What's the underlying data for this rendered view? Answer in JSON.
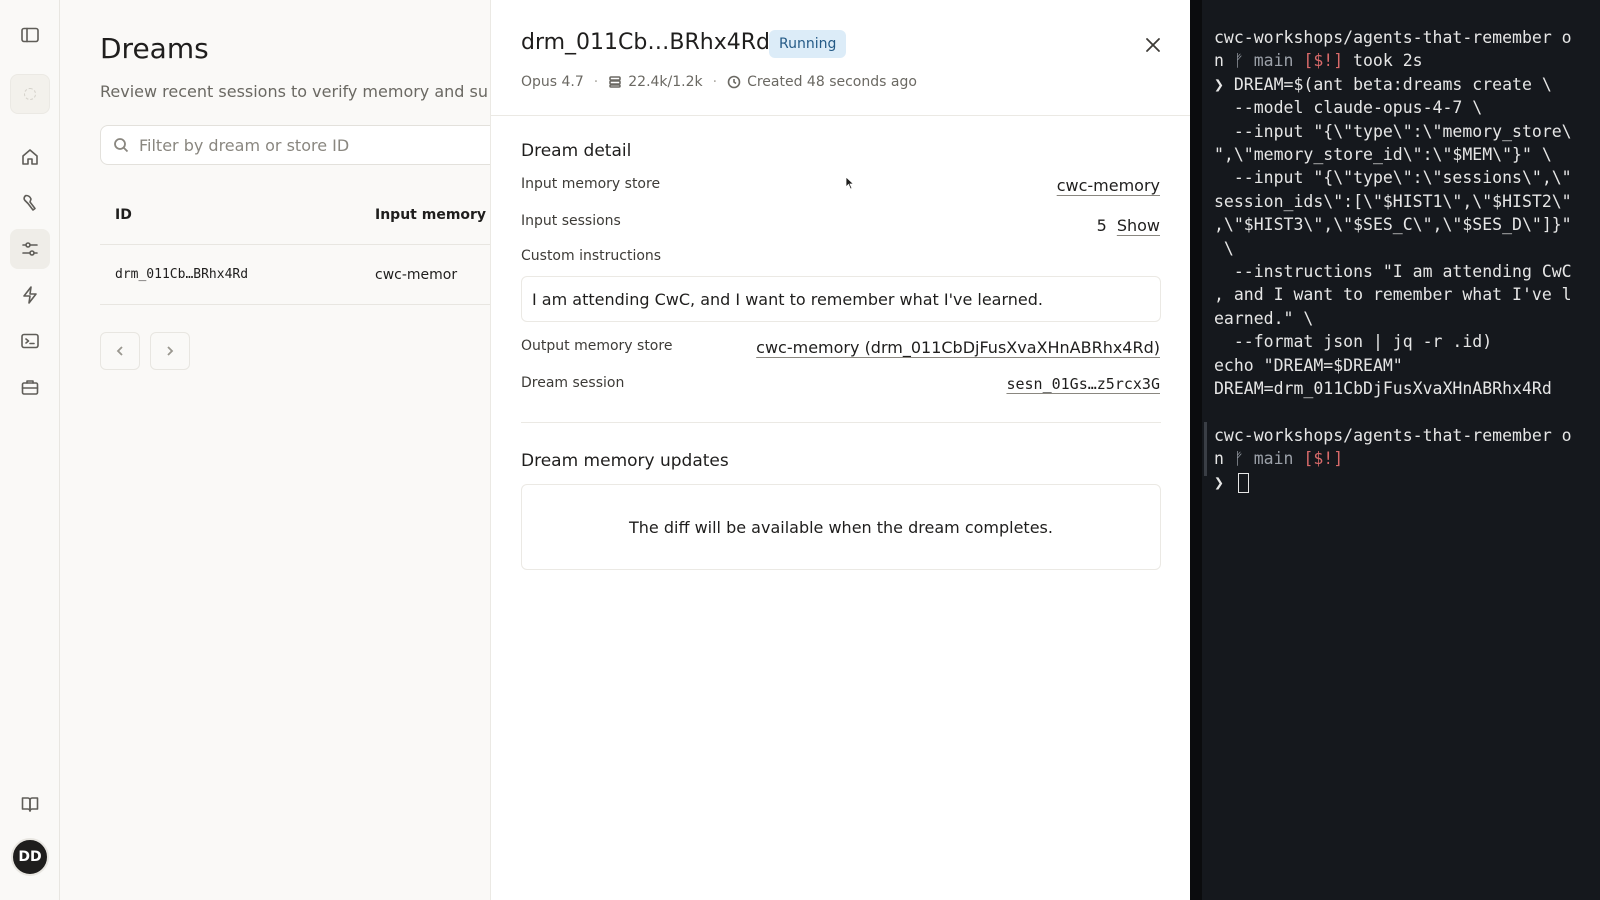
{
  "rail": {
    "items": [
      "sidebar-toggle",
      "home",
      "tools",
      "dreams",
      "events",
      "terminal",
      "briefcase"
    ],
    "docs_icon": "book-icon",
    "avatar_initials": "DD"
  },
  "list": {
    "title": "Dreams",
    "subtitle": "Review recent sessions to verify memory and su",
    "filter_placeholder": "Filter by dream or store ID",
    "columns": [
      "ID",
      "Input memory"
    ],
    "rows": [
      {
        "id": "drm_011Cb…BRhx4Rd",
        "input_memory": "cwc-memor"
      }
    ]
  },
  "detail": {
    "title": "drm_011Cb…BRhx4Rd",
    "status": "Running",
    "model": "Opus 4.7",
    "tokens": "22.4k/1.2k",
    "created": "Created 48 seconds ago",
    "section_detail": "Dream detail",
    "input_store_label": "Input memory store",
    "input_store_value": "cwc-memory",
    "input_sessions_label": "Input sessions",
    "input_sessions_count": "5",
    "input_sessions_show": "Show",
    "custom_instructions_label": "Custom instructions",
    "custom_instructions_value": "I am attending CwC, and I want to remember what I've learned.",
    "output_store_label": "Output memory store",
    "output_store_value": "cwc-memory (drm_011CbDjFusXvaXHnABRhx4Rd)",
    "dream_session_label": "Dream session",
    "dream_session_value": "sesn_01Gs…z5rcx3G",
    "section_updates": "Dream memory updates",
    "diff_message": "The diff will be available when the dream completes."
  },
  "terminal": {
    "l1": "cwc-workshops/agents-that-remember o",
    "l2a": "n ",
    "l2b": "ᚠ main",
    "l2c": " [$!]",
    "l2d": " took 2s",
    "l3": "❯ DREAM=$(ant beta:dreams create \\",
    "l4": "  --model claude-opus-4-7 \\",
    "l5": "  --input \"{\\\"type\\\":\\\"memory_store\\",
    "l6": "\",\\\"memory_store_id\\\":\\\"$MEM\\\"}\" \\",
    "l7": "  --input \"{\\\"type\\\":\\\"sessions\\\",\\\"",
    "l8": "session_ids\\\":[\\\"$HIST1\\\",\\\"$HIST2\\\"",
    "l9": ",\\\"$HIST3\\\",\\\"$SES_C\\\",\\\"$SES_D\\\"]}\"",
    "l10": " \\",
    "l11": "  --instructions \"I am attending CwC",
    "l12": ", and I want to remember what I've l",
    "l13": "earned.\" \\",
    "l14": "  --format json | jq -r .id)",
    "l15": "echo \"DREAM=$DREAM\"",
    "l16": "DREAM=drm_011CbDjFusXvaXHnABRhx4Rd",
    "l17": "cwc-workshops/agents-that-remember o",
    "l18a": "n ",
    "l18b": "ᚠ main",
    "l18c": " [$!]",
    "l19": "❯ "
  }
}
